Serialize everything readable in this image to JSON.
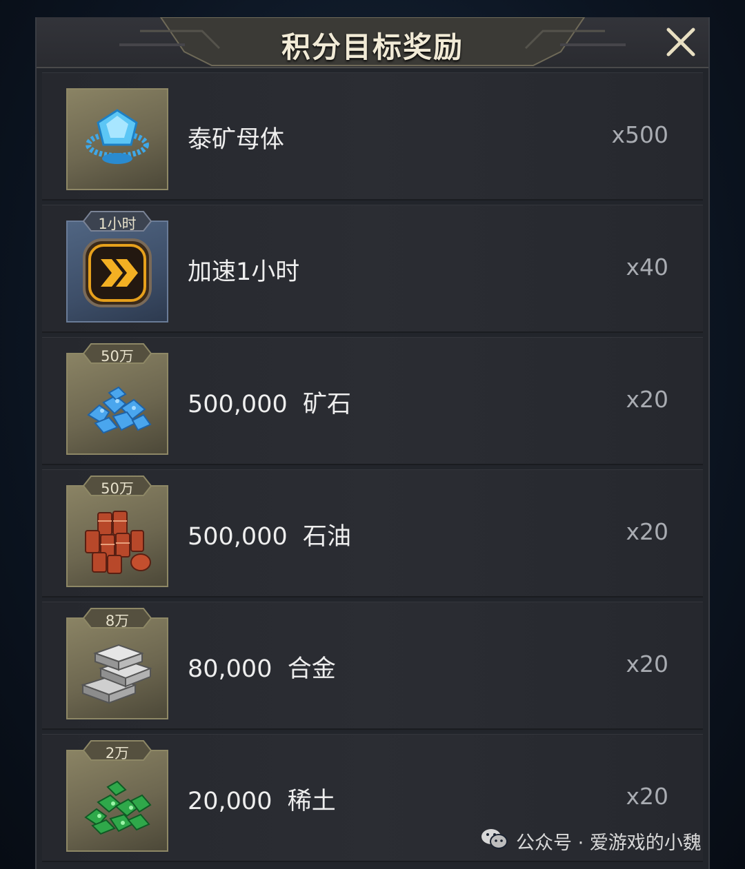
{
  "title": "积分目标奖励",
  "colors": {
    "panel": "#22252b",
    "title": "#f1ead6",
    "quantity": "#a9acb2",
    "icon_gold": "#8a8364",
    "icon_blue": "#506582"
  },
  "rewards": [
    {
      "icon": "titanium-matrix-icon",
      "badge": "",
      "name": "泰矿母体",
      "quantity": "x500"
    },
    {
      "icon": "speedup-icon",
      "badge": "1小时",
      "name": "加速1小时",
      "quantity": "x40"
    },
    {
      "icon": "ore-icon",
      "badge": "50万",
      "name": "500,000  矿石",
      "quantity": "x20"
    },
    {
      "icon": "oil-barrels-icon",
      "badge": "50万",
      "name": "500,000  石油",
      "quantity": "x20"
    },
    {
      "icon": "alloy-ingots-icon",
      "badge": "8万",
      "name": "80,000  合金",
      "quantity": "x20"
    },
    {
      "icon": "rare-earth-icon",
      "badge": "2万",
      "name": "20,000  稀土",
      "quantity": "x20"
    }
  ],
  "watermark": {
    "icon": "wechat-icon",
    "text": "公众号 · 爱游戏的小魏"
  }
}
